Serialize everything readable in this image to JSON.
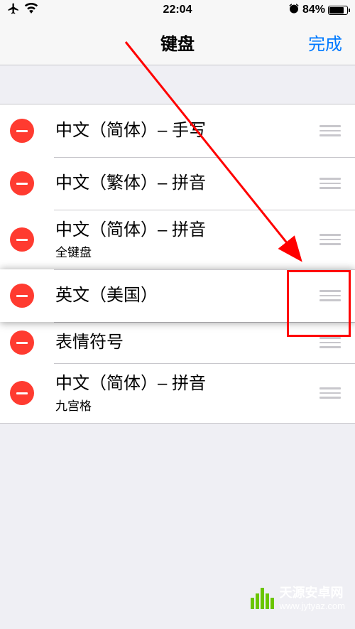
{
  "status": {
    "time": "22:04",
    "battery_percent": "84%"
  },
  "nav": {
    "title": "键盘",
    "done": "完成"
  },
  "keyboards": [
    {
      "title": "中文（简体）– 手写",
      "subtitle": ""
    },
    {
      "title": "中文（繁体）– 拼音",
      "subtitle": ""
    },
    {
      "title": "中文（简体）– 拼音",
      "subtitle": "全键盘"
    },
    {
      "title": "英文（美国）",
      "subtitle": ""
    },
    {
      "title": "表情符号",
      "subtitle": ""
    },
    {
      "title": "中文（简体）– 拼音",
      "subtitle": "九宫格"
    }
  ],
  "watermark": {
    "name": "天源安卓网",
    "url": "www.jytyaz.com"
  }
}
